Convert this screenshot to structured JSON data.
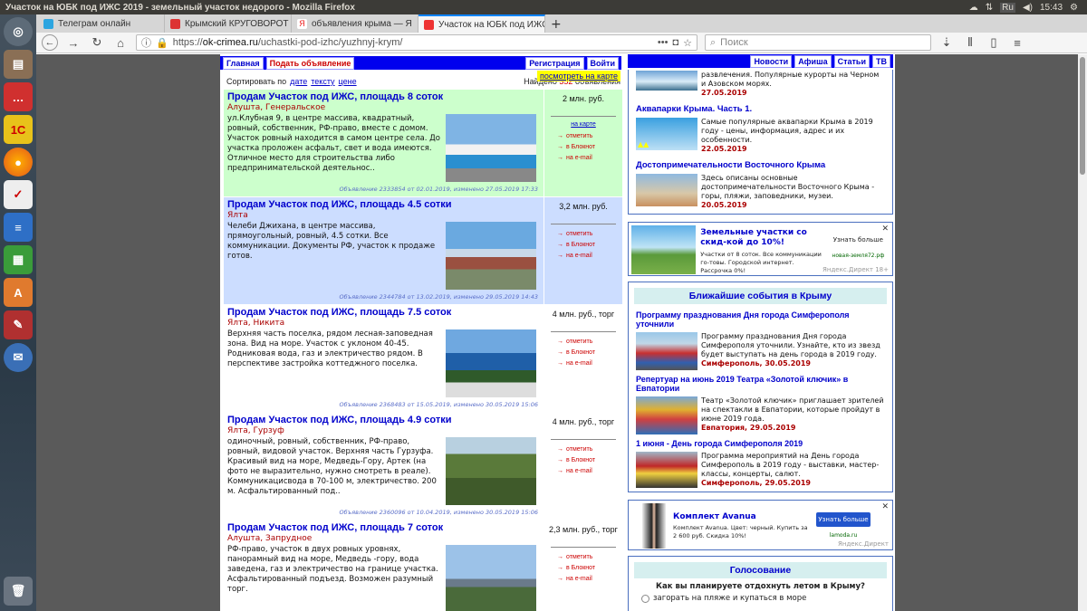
{
  "os": {
    "window_title": "Участок на ЮБК под ИЖС 2019 - земельный участок недорого - Mozilla Firefox",
    "lang": "Ru",
    "clock": "15:43"
  },
  "tabs": [
    {
      "label": "Телеграм онлайн",
      "color": "#2ca5e0"
    },
    {
      "label": "Крымский КРУГОВОРОТ",
      "color": "#d33"
    },
    {
      "label": "объявления крыма — Я",
      "color": "#e22"
    },
    {
      "label": "Участок на ЮБК под ИЖС",
      "color": "#e33",
      "active": true
    }
  ],
  "navbar": {
    "url_prefix": "https://",
    "url_domain": "ok-crimea.ru",
    "url_path": "/uchastki-pod-izhc/yuzhnyj-krym/",
    "search_placeholder": "Поиск"
  },
  "sitenav": {
    "home": "Главная",
    "post_ad": "Подать объявление",
    "register": "Регистрация",
    "login": "Войти",
    "news": "Новости",
    "afisha": "Афиша",
    "articles": "Статьи",
    "tv": "ТВ"
  },
  "listing": {
    "sort_label": "Сортировать по",
    "sort_date": "дате",
    "sort_text": "тексту",
    "sort_price": "цене",
    "show_map": "посмотреть на карте",
    "found_prefix": "Найдено",
    "found_count": "352",
    "found_suffix": "объявления",
    "ads": [
      {
        "title": "Продам Участок под ИЖС, площадь 8 соток",
        "location": "Алушта, Генеральское",
        "description": "ул.Клубная 9, в центре массива, квадратный, ровный, собственник, РФ-право, вместе с домом. Участок ровный находится в самом центре села. До участка проложен асфальт, свет и вода имеются. Отличное место для строительства либо предпринимательской деятельнос..",
        "meta": "Объявление 2333854 от 02.01.2019, изменено 27.05.2019 17:33",
        "price": "2 млн. руб.",
        "map_link": "на карте",
        "bg": "green"
      },
      {
        "title": "Продам Участок под ИЖС, площадь 4.5 сотки",
        "location": "Ялта",
        "description": "Челеби Джихана, в центре массива, прямоугольный, ровный, 4.5 сотки. Все коммуникации. Документы РФ, участок к продаже готов.",
        "meta": "Объявление 2344784 от 13.02.2019, изменено 29.05.2019 14:43",
        "price": "3,2 млн. руб.",
        "bg": "blue"
      },
      {
        "title": "Продам Участок под ИЖС, площадь 7.5 соток",
        "location": "Ялта, Никита",
        "description": "Верхняя часть поселка, рядом лесная-заповедная зона. Вид на море. Участок с уклоном 40-45. Родниковая вода, газ и электричество рядом. В перспективе застройка коттеджного поселка.",
        "meta": "Объявление 2368483 от 15.05.2019, изменено 30.05.2019 15:06",
        "price": "4 млн. руб., торг",
        "bg": "white"
      },
      {
        "title": "Продам Участок под ИЖС, площадь 4.9 сотки",
        "location": "Ялта, Гурзуф",
        "description": "одиночный, ровный, собственник, РФ-право, ровный, видовой участок. Верхняя часть Гурзуфа. Красивый вид на море, Медведь-Гору, Артек (на фото не выразительно, нужно смотреть в реале). Коммуникацисвода в 70-100 м, электричество. 200 м. Асфальтированный под..",
        "meta": "Объявление 2360096 от 10.04.2019, изменено 30.05.2019 15:06",
        "price": "4 млн. руб., торг",
        "bg": "white"
      },
      {
        "title": "Продам Участок под ИЖС, площадь 7 соток",
        "location": "Алушта, Запрудное",
        "description": "РФ-право, участок в двух ровных уровнях, панорамный вид на море, Медведь -гору, вода заведена, газ и электричество на границе участка. Асфальтированный подъезд. Возможен разумный торг.",
        "meta": "Объявление 2360078 от 10.04.2019, изменено 30.05.2019 15:06",
        "price": "2,3 млн. руб., торг",
        "bg": "white"
      }
    ],
    "actions": {
      "mark": "отметить",
      "notebook": "в Блокнот",
      "email": "на e-mail"
    }
  },
  "sidebar": {
    "articles": [
      {
        "title": "",
        "text": "развлечения. Популярные курорты на Черном и Азовском морях.",
        "date": "27.05.2019"
      },
      {
        "title": "Аквапарки Крыма. Часть 1.",
        "text": "Самые популярные аквапарки Крыма в 2019 году - цены, информация, адрес и их особенности.",
        "date": "22.05.2019"
      },
      {
        "title": "Достопримечательности Восточного Крыма",
        "text": "Здесь описаны основные достопримечательности Восточного Крыма - горы, пляжи, заповедники, музеи.",
        "date": "20.05.2019"
      }
    ],
    "ad1": {
      "title": "Земельные участки со скид-кой до 10%!",
      "text": "Участки от 8 соток. Все коммуникации го-товы. Городской интернет. Рассрочка 0%!",
      "cta": "Узнать больше",
      "domain": "новая-земля72.рф",
      "tag": "Яндекс.Директ 18+"
    },
    "events": {
      "header": "Ближайшие события в Крыму",
      "items": [
        {
          "title": "Программу празднования Дня города Симферополя уточнили",
          "text": "Программу празднования Дня города Симферополя уточнили. Узнайте, кто из звезд будет выступать на день города в 2019 году.",
          "place": "Симферополь, 30.05.2019"
        },
        {
          "title": "Репертуар на июнь 2019 Театра «Золотой ключик» в Евпатории",
          "text": "Театр «Золотой ключик» приглашает зрителей на спектакли в Евпатории, которые пройдут в июне 2019 года.",
          "place": "Евпатория, 29.05.2019"
        },
        {
          "title": "1 июня - День города Симферополя 2019",
          "text": "Программа мероприятий на День города Симферополь в 2019 году - выставки, мастер-классы, концерты, салют.",
          "place": "Симферополь, 29.05.2019"
        }
      ]
    },
    "ad2": {
      "title": "Комплект Avanua",
      "text": "Комплект Avanua. Цвет: черный. Купить за 2 600 руб. Скидка 10%!",
      "cta": "Узнать больше",
      "domain": "lamoda.ru",
      "tag": "Яндекс.Директ"
    },
    "poll": {
      "header": "Голосование",
      "question": "Как вы планируете отдохнуть летом в Крыму?",
      "option1": "загорать на пляже и купаться в море"
    }
  }
}
